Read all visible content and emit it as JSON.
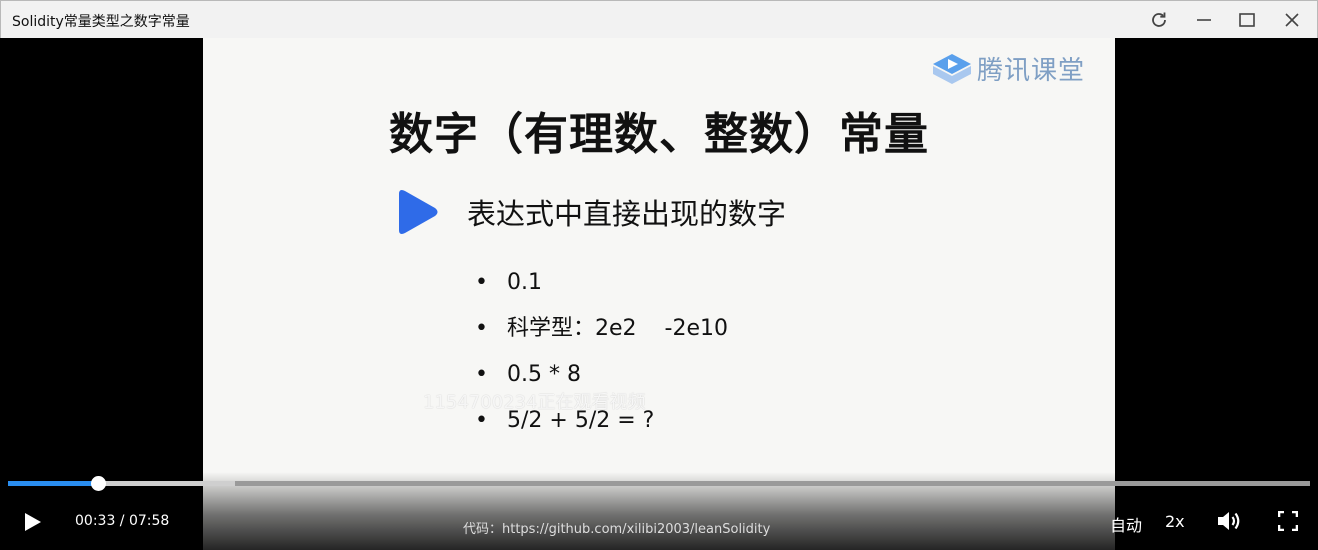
{
  "window": {
    "title": "Solidity常量类型之数字常量"
  },
  "slide": {
    "brand": "腾讯课堂",
    "title": "数字（有理数、整数）常量",
    "subheading": "表达式中直接出现的数字",
    "bullets": [
      {
        "mark": "•",
        "text": "0.1"
      },
      {
        "mark": "•",
        "text": "科学型：2e2    -2e10"
      },
      {
        "mark": "•",
        "text": "0.5 * 8"
      },
      {
        "mark": "•",
        "text": "5/2 + 5/2 = ?"
      }
    ],
    "watermark": "1154700234正在观看视频"
  },
  "player": {
    "current_time": "00:33",
    "total_time": "07:58",
    "time_display": "00:33 / 07:58",
    "progress_fraction": 0.069,
    "buffered_fraction": 0.174,
    "code_caption": "代码：https://github.com/xilibi2003/leanSolidity",
    "quality_label": "自动",
    "speed_label": "2x"
  },
  "colors": {
    "progress_played": "#2a8ef0",
    "brand_blue": "#7f9fc4",
    "play_icon_blue": "#2f6be8"
  },
  "icons": [
    "refresh-icon",
    "minimize-icon",
    "maximize-icon",
    "close-icon",
    "play-icon",
    "volume-icon",
    "fullscreen-icon"
  ]
}
